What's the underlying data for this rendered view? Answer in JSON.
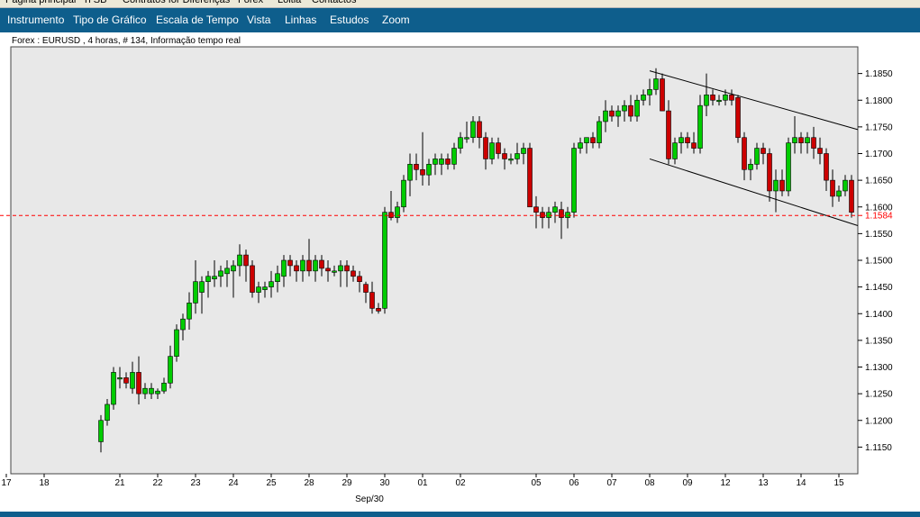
{
  "nav_tabs": [
    "Página principal",
    "Ti SB",
    "Contratos for Diferenças",
    "Forex",
    "Loitia",
    "Contactos"
  ],
  "menu": [
    "Instrumento",
    "Tipo de Gráfico",
    "Escala de Tempo",
    "Vista",
    "Linhas",
    "Estudos",
    "Zoom"
  ],
  "chart_header": "Forex : EURUSD , 4 horas, # 134, Informação tempo real",
  "colors": {
    "up": "#00cc00",
    "down": "#cc0000",
    "plot_bg": "#e8e8e8",
    "menu_bg": "#0e5e8c",
    "current_price": "#ff0000"
  },
  "chart_data": {
    "type": "candlestick",
    "instrument": "EURUSD",
    "interval": "4 horas",
    "current_price": 1.1584,
    "current_price_label": "1.1584",
    "ylim": [
      1.11,
      1.19
    ],
    "y_ticks": [
      "1.1850",
      "1.1800",
      "1.1750",
      "1.1700",
      "1.1650",
      "1.1600",
      "1.1550",
      "1.1500",
      "1.1450",
      "1.1400",
      "1.1350",
      "1.1300",
      "1.1250",
      "1.1200",
      "1.1150"
    ],
    "x_ticks": [
      "17",
      "18",
      "21",
      "22",
      "23",
      "24",
      "25",
      "28",
      "29",
      "30",
      "01",
      "02",
      "05",
      "06",
      "07",
      "08",
      "09",
      "12",
      "13",
      "14",
      "15"
    ],
    "x_sublabel": "Sep/30",
    "channel": {
      "upper": [
        1.1855,
        1.1745
      ],
      "lower": [
        1.169,
        1.1565
      ]
    },
    "candles": [
      [
        1.116,
        1.121,
        1.114,
        1.12
      ],
      [
        1.12,
        1.124,
        1.119,
        1.123
      ],
      [
        1.123,
        1.13,
        1.122,
        1.129
      ],
      [
        1.128,
        1.13,
        1.126,
        1.128
      ],
      [
        1.128,
        1.129,
        1.126,
        1.127
      ],
      [
        1.126,
        1.131,
        1.125,
        1.129
      ],
      [
        1.129,
        1.132,
        1.123,
        1.125
      ],
      [
        1.125,
        1.127,
        1.124,
        1.126
      ],
      [
        1.125,
        1.127,
        1.124,
        1.126
      ],
      [
        1.125,
        1.126,
        1.124,
        1.1255
      ],
      [
        1.1255,
        1.128,
        1.125,
        1.127
      ],
      [
        1.127,
        1.134,
        1.126,
        1.132
      ],
      [
        1.132,
        1.138,
        1.131,
        1.137
      ],
      [
        1.137,
        1.14,
        1.135,
        1.139
      ],
      [
        1.139,
        1.144,
        1.137,
        1.142
      ],
      [
        1.142,
        1.15,
        1.14,
        1.146
      ],
      [
        1.144,
        1.147,
        1.14,
        1.146
      ],
      [
        1.146,
        1.148,
        1.143,
        1.147
      ],
      [
        1.1465,
        1.15,
        1.145,
        1.147
      ],
      [
        1.147,
        1.149,
        1.145,
        1.148
      ],
      [
        1.1475,
        1.15,
        1.145,
        1.1485
      ],
      [
        1.148,
        1.15,
        1.143,
        1.149
      ],
      [
        1.149,
        1.153,
        1.147,
        1.151
      ],
      [
        1.151,
        1.152,
        1.146,
        1.149
      ],
      [
        1.149,
        1.15,
        1.143,
        1.144
      ],
      [
        1.144,
        1.146,
        1.142,
        1.145
      ],
      [
        1.1445,
        1.146,
        1.143,
        1.145
      ],
      [
        1.145,
        1.148,
        1.143,
        1.146
      ],
      [
        1.146,
        1.149,
        1.144,
        1.1475
      ],
      [
        1.147,
        1.151,
        1.145,
        1.15
      ],
      [
        1.15,
        1.151,
        1.147,
        1.149
      ],
      [
        1.149,
        1.15,
        1.146,
        1.148
      ],
      [
        1.148,
        1.151,
        1.146,
        1.15
      ],
      [
        1.15,
        1.154,
        1.147,
        1.148
      ],
      [
        1.148,
        1.151,
        1.146,
        1.15
      ],
      [
        1.15,
        1.151,
        1.147,
        1.1485
      ],
      [
        1.1485,
        1.15,
        1.146,
        1.148
      ],
      [
        1.148,
        1.149,
        1.147,
        1.148
      ],
      [
        1.148,
        1.15,
        1.145,
        1.149
      ],
      [
        1.149,
        1.15,
        1.145,
        1.148
      ],
      [
        1.148,
        1.149,
        1.146,
        1.147
      ],
      [
        1.147,
        1.148,
        1.144,
        1.146
      ],
      [
        1.1455,
        1.146,
        1.142,
        1.144
      ],
      [
        1.144,
        1.146,
        1.14,
        1.141
      ],
      [
        1.141,
        1.142,
        1.14,
        1.1405
      ],
      [
        1.141,
        1.16,
        1.14,
        1.159
      ],
      [
        1.159,
        1.163,
        1.1575,
        1.158
      ],
      [
        1.158,
        1.161,
        1.157,
        1.16
      ],
      [
        1.16,
        1.166,
        1.159,
        1.165
      ],
      [
        1.165,
        1.17,
        1.162,
        1.168
      ],
      [
        1.168,
        1.17,
        1.165,
        1.167
      ],
      [
        1.167,
        1.174,
        1.164,
        1.166
      ],
      [
        1.166,
        1.169,
        1.164,
        1.168
      ],
      [
        1.168,
        1.17,
        1.166,
        1.169
      ],
      [
        1.168,
        1.17,
        1.166,
        1.169
      ],
      [
        1.169,
        1.17,
        1.167,
        1.168
      ],
      [
        1.168,
        1.172,
        1.167,
        1.171
      ],
      [
        1.171,
        1.174,
        1.17,
        1.173
      ],
      [
        1.173,
        1.176,
        1.172,
        1.173
      ],
      [
        1.173,
        1.177,
        1.172,
        1.176
      ],
      [
        1.176,
        1.177,
        1.171,
        1.173
      ],
      [
        1.173,
        1.174,
        1.167,
        1.169
      ],
      [
        1.169,
        1.173,
        1.168,
        1.172
      ],
      [
        1.172,
        1.173,
        1.169,
        1.17
      ],
      [
        1.17,
        1.171,
        1.167,
        1.169
      ],
      [
        1.169,
        1.17,
        1.168,
        1.169
      ],
      [
        1.169,
        1.172,
        1.168,
        1.17
      ],
      [
        1.17,
        1.172,
        1.168,
        1.171
      ],
      [
        1.171,
        1.172,
        1.161,
        1.16
      ],
      [
        1.16,
        1.162,
        1.156,
        1.159
      ],
      [
        1.159,
        1.16,
        1.156,
        1.158
      ],
      [
        1.158,
        1.16,
        1.156,
        1.159
      ],
      [
        1.159,
        1.161,
        1.157,
        1.16
      ],
      [
        1.1595,
        1.161,
        1.154,
        1.158
      ],
      [
        1.158,
        1.16,
        1.156,
        1.159
      ],
      [
        1.159,
        1.172,
        1.158,
        1.171
      ],
      [
        1.171,
        1.173,
        1.17,
        1.172
      ],
      [
        1.172,
        1.173,
        1.17,
        1.173
      ],
      [
        1.173,
        1.174,
        1.171,
        1.172
      ],
      [
        1.172,
        1.177,
        1.171,
        1.176
      ],
      [
        1.176,
        1.18,
        1.174,
        1.178
      ],
      [
        1.178,
        1.179,
        1.176,
        1.177
      ],
      [
        1.177,
        1.179,
        1.175,
        1.178
      ],
      [
        1.178,
        1.18,
        1.176,
        1.179
      ],
      [
        1.179,
        1.181,
        1.176,
        1.177
      ],
      [
        1.177,
        1.181,
        1.176,
        1.18
      ],
      [
        1.18,
        1.182,
        1.179,
        1.181
      ],
      [
        1.181,
        1.184,
        1.179,
        1.182
      ],
      [
        1.182,
        1.186,
        1.181,
        1.184
      ],
      [
        1.184,
        1.185,
        1.178,
        1.178
      ],
      [
        1.178,
        1.18,
        1.168,
        1.169
      ],
      [
        1.169,
        1.173,
        1.168,
        1.172
      ],
      [
        1.172,
        1.174,
        1.17,
        1.173
      ],
      [
        1.173,
        1.174,
        1.171,
        1.172
      ],
      [
        1.172,
        1.174,
        1.17,
        1.171
      ],
      [
        1.171,
        1.181,
        1.17,
        1.179
      ],
      [
        1.179,
        1.185,
        1.177,
        1.181
      ],
      [
        1.181,
        1.182,
        1.179,
        1.18
      ],
      [
        1.18,
        1.181,
        1.179,
        1.18
      ],
      [
        1.18,
        1.182,
        1.179,
        1.181
      ],
      [
        1.181,
        1.182,
        1.179,
        1.18
      ],
      [
        1.1805,
        1.181,
        1.172,
        1.173
      ],
      [
        1.173,
        1.174,
        1.165,
        1.167
      ],
      [
        1.167,
        1.169,
        1.165,
        1.168
      ],
      [
        1.168,
        1.172,
        1.167,
        1.171
      ],
      [
        1.171,
        1.172,
        1.168,
        1.17
      ],
      [
        1.17,
        1.171,
        1.161,
        1.163
      ],
      [
        1.163,
        1.167,
        1.159,
        1.165
      ],
      [
        1.165,
        1.167,
        1.162,
        1.163
      ],
      [
        1.163,
        1.173,
        1.162,
        1.172
      ],
      [
        1.172,
        1.177,
        1.17,
        1.173
      ],
      [
        1.173,
        1.174,
        1.17,
        1.172
      ],
      [
        1.172,
        1.174,
        1.17,
        1.173
      ],
      [
        1.173,
        1.175,
        1.169,
        1.171
      ],
      [
        1.171,
        1.173,
        1.168,
        1.17
      ],
      [
        1.17,
        1.171,
        1.163,
        1.165
      ],
      [
        1.165,
        1.167,
        1.16,
        1.162
      ],
      [
        1.162,
        1.164,
        1.161,
        1.163
      ],
      [
        1.163,
        1.166,
        1.162,
        1.165
      ],
      [
        1.165,
        1.166,
        1.158,
        1.159
      ]
    ]
  }
}
